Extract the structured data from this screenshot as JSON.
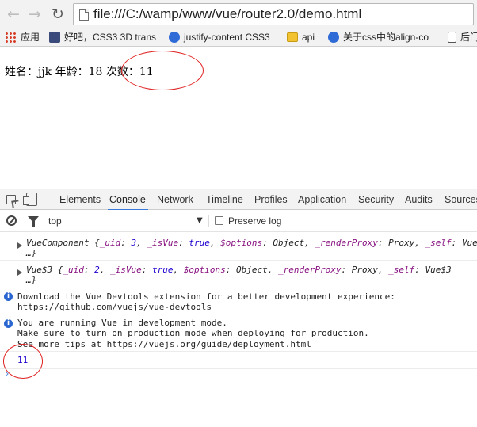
{
  "browser": {
    "url": "file:///C:/wamp/www/vue/router2.0/demo.html",
    "bookmarks": [
      {
        "label": "应用",
        "icon": "apps-grid-icon"
      },
      {
        "label": "好吧，CSS3 3D trans",
        "icon": "bookmark-favicon-icon"
      },
      {
        "label": "justify-content CSS3",
        "icon": "blue-favicon-icon"
      },
      {
        "label": "api",
        "icon": "folder-icon"
      },
      {
        "label": "关于css中的align-co",
        "icon": "blue-favicon-icon"
      },
      {
        "label": "后门",
        "icon": "document-icon"
      }
    ]
  },
  "page": {
    "name_label": "姓名：",
    "name_value": "jjk",
    "age_label": "年龄：",
    "age_value": "18",
    "count_label": "次数：",
    "count_value": "11"
  },
  "devtools": {
    "tabs": [
      "Elements",
      "Console",
      "Network",
      "Timeline",
      "Profiles",
      "Application",
      "Security",
      "Audits",
      "Sources"
    ],
    "active_tab": "Console",
    "context": "top",
    "preserve_log_label": "Preserve log",
    "messages": {
      "vue_component": {
        "name": "VueComponent",
        "open": " {",
        "uid_key": "_uid",
        "uid_val": "3",
        "isvue_key": "_isVue",
        "isvue_val": "true",
        "options_key": "$options",
        "options_val": "Object",
        "render_key": "_renderProxy",
        "render_val": "Proxy",
        "self_key": "_self",
        "self_val": "Vue",
        "more": "…}"
      },
      "vue_root": {
        "name": "Vue$3",
        "open": " {",
        "uid_key": "_uid",
        "uid_val": "2",
        "isvue_key": "_isVue",
        "isvue_val": "true",
        "options_key": "$options",
        "options_val": "Object",
        "render_key": "_renderProxy",
        "render_val": "Proxy",
        "self_key": "_self",
        "self_val": "Vue$3",
        "more": "…}"
      },
      "devtools_info": [
        "Download the Vue Devtools extension for a better development experience:",
        "https://github.com/vuejs/vue-devtools"
      ],
      "dev_mode_info": [
        "You are running Vue in development mode.",
        "Make sure to turn on production mode when deploying for production.",
        "See more tips at https://vuejs.org/guide/deployment.html"
      ],
      "output_value": "11"
    },
    "prompt_symbol": "›"
  },
  "annotation": {
    "color": "#e02020"
  }
}
